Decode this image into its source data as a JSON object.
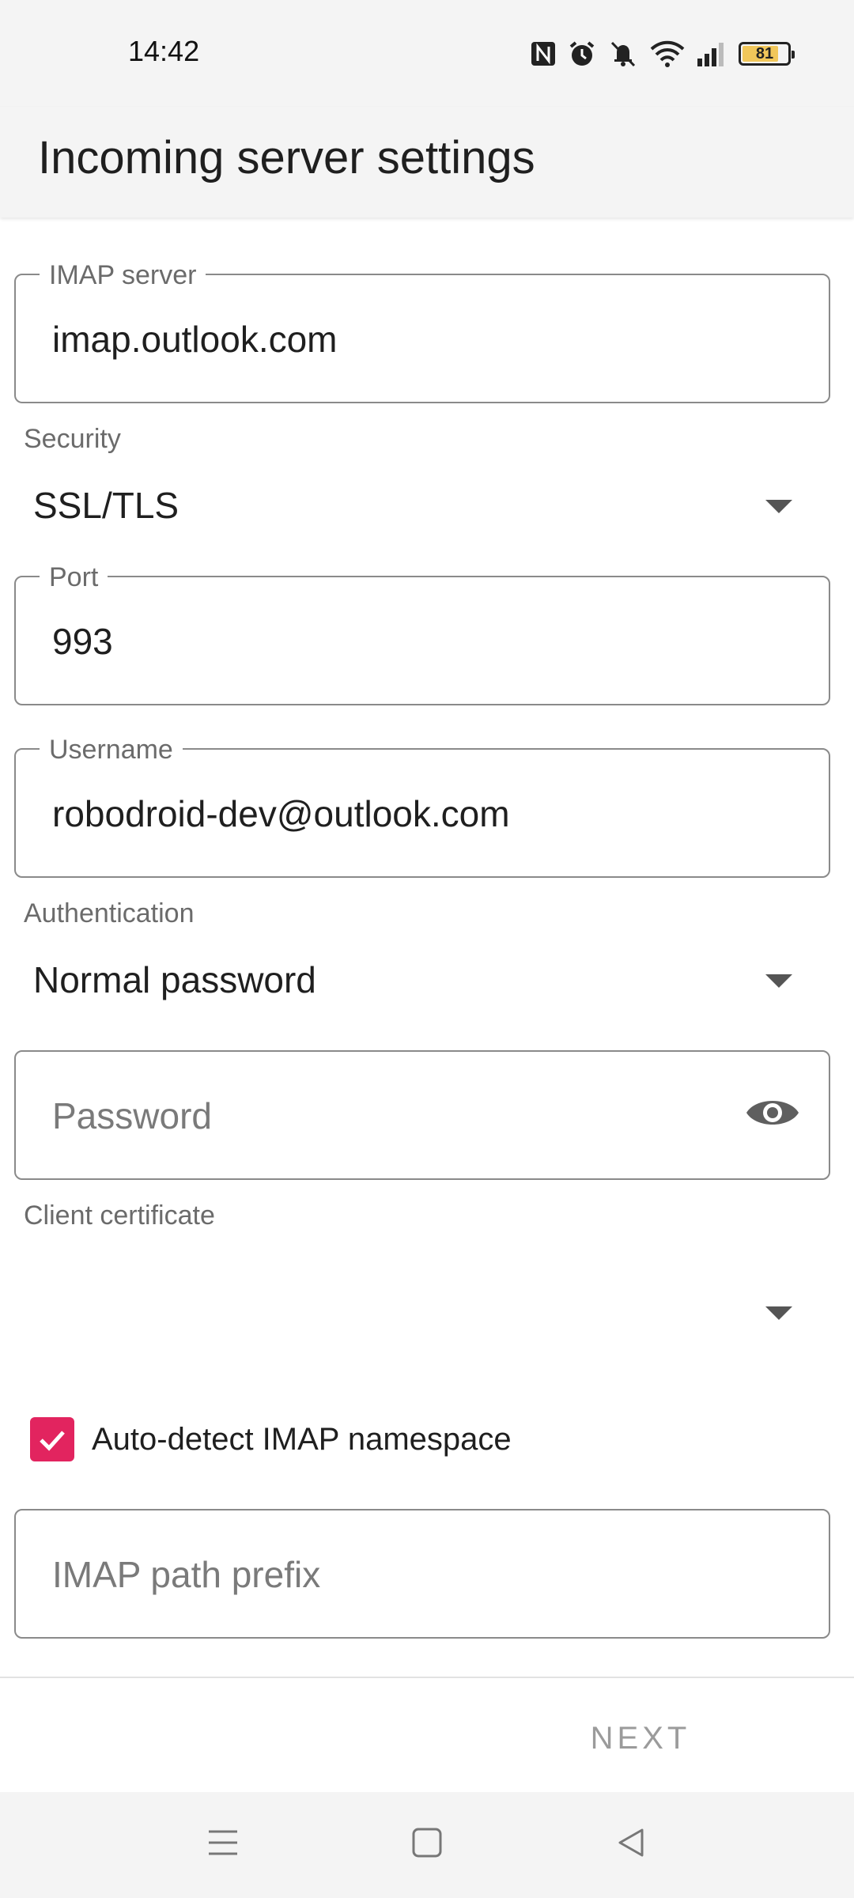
{
  "status_bar": {
    "time": "14:42",
    "battery_level": "81",
    "icons": [
      "nfc-icon",
      "alarm-icon",
      "mute-icon",
      "wifi-icon",
      "signal-icon",
      "battery-icon"
    ]
  },
  "app_bar": {
    "title": "Incoming server settings"
  },
  "form": {
    "imap_server": {
      "label": "IMAP server",
      "value": "imap.outlook.com"
    },
    "security": {
      "label": "Security",
      "value": "SSL/TLS"
    },
    "port": {
      "label": "Port",
      "value": "993"
    },
    "username": {
      "label": "Username",
      "value": "robodroid-dev@outlook.com"
    },
    "authentication": {
      "label": "Authentication",
      "value": "Normal password"
    },
    "password": {
      "placeholder": "Password",
      "value": ""
    },
    "client_certificate": {
      "label": "Client certificate",
      "value": ""
    },
    "auto_detect": {
      "label": "Auto-detect IMAP namespace",
      "checked": true
    },
    "path_prefix": {
      "placeholder": "IMAP path prefix",
      "value": ""
    }
  },
  "actions": {
    "next_label": "NEXT"
  },
  "colors": {
    "accent": "#e2245f",
    "background": "#ffffff",
    "bar_background": "#f4f4f4",
    "disabled_text": "#9b9b9b"
  },
  "nav_bar": {
    "buttons": [
      "menu-icon",
      "home-icon",
      "back-icon"
    ]
  }
}
